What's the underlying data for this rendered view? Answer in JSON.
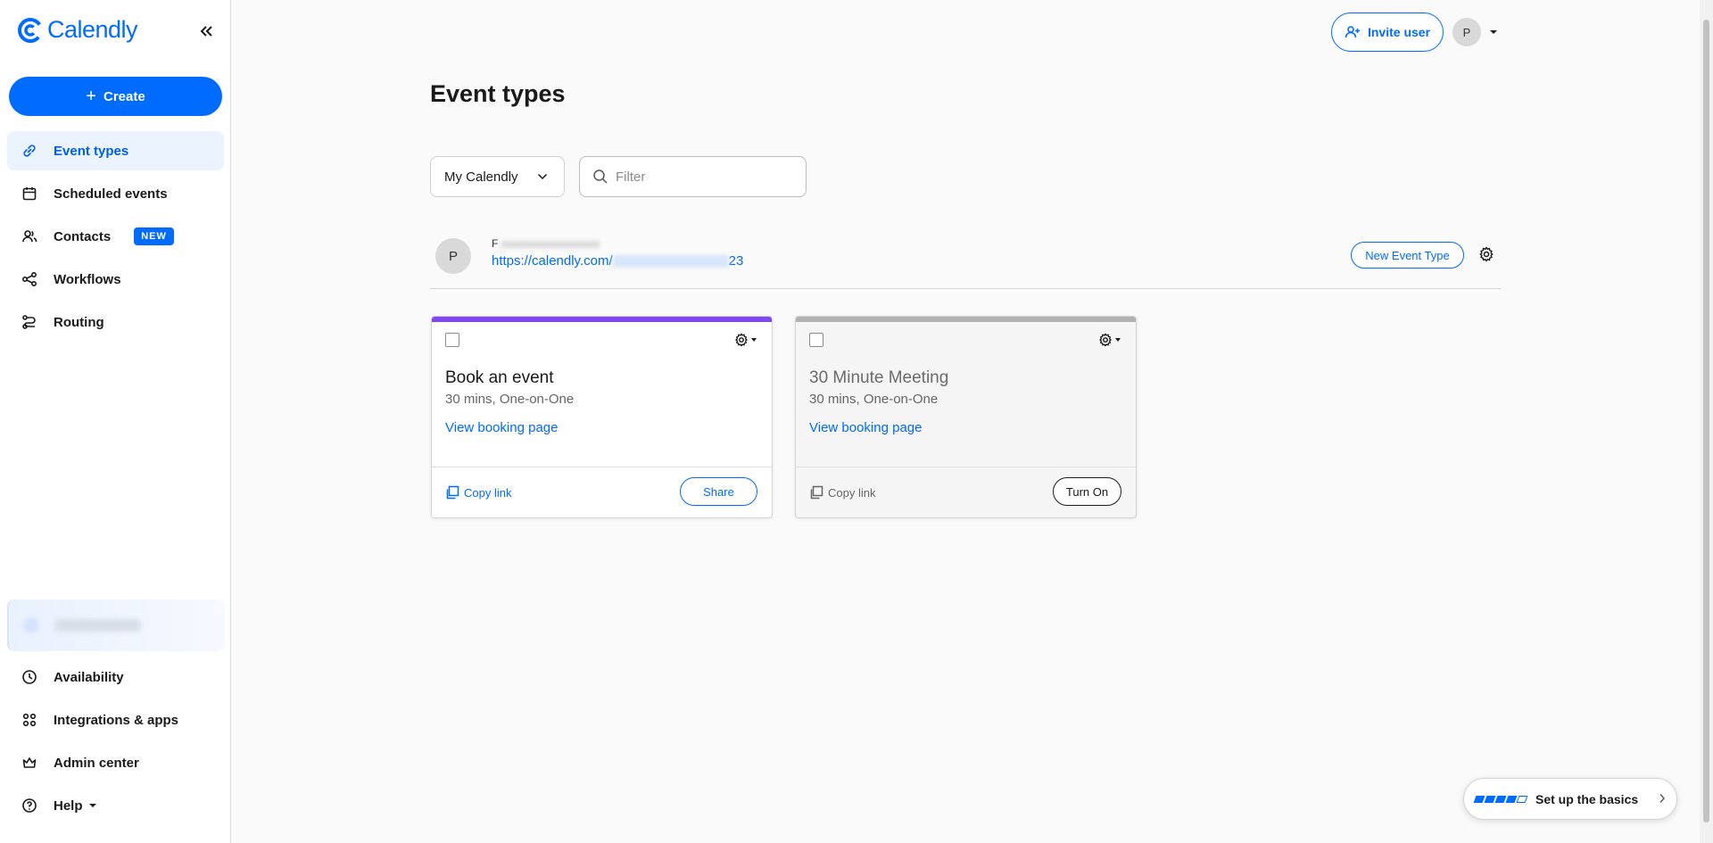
{
  "app": {
    "brand": "Calendly",
    "accent": "#006bff"
  },
  "sidebar": {
    "create_label": "Create",
    "items": [
      {
        "label": "Event types",
        "icon": "link-icon",
        "active": true
      },
      {
        "label": "Scheduled events",
        "icon": "calendar-icon"
      },
      {
        "label": "Contacts",
        "icon": "contacts-icon",
        "badge": "NEW"
      },
      {
        "label": "Workflows",
        "icon": "workflows-icon"
      },
      {
        "label": "Routing",
        "icon": "routing-icon"
      }
    ],
    "bottom_items": [
      {
        "label": "Availability",
        "icon": "clock-icon"
      },
      {
        "label": "Integrations & apps",
        "icon": "apps-grid-icon"
      },
      {
        "label": "Admin center",
        "icon": "crown-icon"
      },
      {
        "label": "Help",
        "icon": "help-icon"
      }
    ]
  },
  "header": {
    "invite_label": "Invite user",
    "avatar_initial": "P"
  },
  "main": {
    "title": "Event types",
    "select_value": "My Calendly",
    "filter_placeholder": "Filter",
    "user": {
      "initial": "P",
      "name_visible": "F",
      "link_prefix": "https://calendly.com/",
      "link_suffix": "23"
    },
    "new_event_label": "New Event Type",
    "cards": [
      {
        "title": "Book an event",
        "subtitle": "30 mins, One-on-One",
        "view_label": "View booking page",
        "copy_label": "Copy link",
        "action_label": "Share",
        "color": "#8247f5",
        "enabled": true
      },
      {
        "title": "30 Minute Meeting",
        "subtitle": "30 mins, One-on-One",
        "view_label": "View booking page",
        "copy_label": "Copy link",
        "action_label": "Turn On",
        "color": "#b2b2b2",
        "enabled": false
      }
    ]
  },
  "setup": {
    "label": "Set up the basics",
    "progress": 0.8
  }
}
